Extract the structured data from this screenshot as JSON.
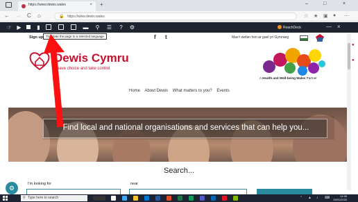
{
  "browser": {
    "tab_title": "https://www.dewis.wales",
    "tab_close": "×",
    "new_tab": "+",
    "url": "https://www.dewis.wales",
    "window_controls": [
      "–",
      "□",
      "×"
    ]
  },
  "nav_buttons": [
    "←",
    "→",
    "C",
    "⌂"
  ],
  "reachdeck": {
    "brand": "ReachDeck",
    "tooltip": "Translate the page to a selected language",
    "minimize": "—",
    "close": "×"
  },
  "header": {
    "signup": "Sign up",
    "social": [
      "f",
      "t"
    ],
    "language_link": "Mae'r wefan hon ar gael yn Gymraeg"
  },
  "logo": {
    "name": "Dewis Cymru",
    "tagline": "have choice and take control"
  },
  "partner": {
    "text_prefix": "A ",
    "text_bold": "Health and Well-being Wales",
    "text_suffix": " Partner"
  },
  "main_nav": [
    "Home",
    "About Dewis",
    "What matters to you?",
    "Events"
  ],
  "hero": {
    "banner": "Find local and national organisations and services that can help you..."
  },
  "search": {
    "title": "Search...",
    "looking_for_label": "I'm looking for",
    "near_label": "near"
  },
  "taskbar": {
    "search_placeholder": "Type here to search",
    "time": "14:06",
    "date": "15/01/2020"
  },
  "colors": {
    "brand_red": "#c8102e",
    "toolbar_bg": "#1f2530",
    "teal": "#2a8a9e",
    "arrow": "#ff1010"
  }
}
